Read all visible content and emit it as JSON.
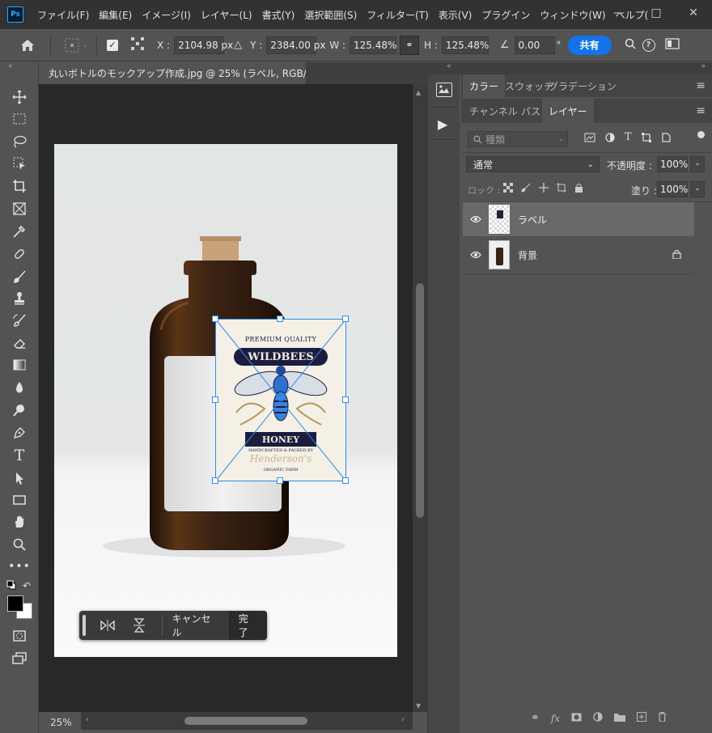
{
  "app": {
    "logo": "Ps"
  },
  "menu": [
    "ファイル(F)",
    "編集(E)",
    "イメージ(I)",
    "レイヤー(L)",
    "書式(Y)",
    "選択範囲(S)",
    "フィルター(T)",
    "表示(V)",
    "プラグイン",
    "ウィンドウ(W)",
    "ヘルプ("
  ],
  "options": {
    "x_label": "X :",
    "x_value": "2104.98 px",
    "y_label": "Y :",
    "y_value": "2384.00 px",
    "w_label": "W :",
    "w_value": "125.48%",
    "h_label": "H :",
    "h_value": "125.48%",
    "angle_value": "0.00",
    "degree": "°",
    "share_label": "共有"
  },
  "document": {
    "tab_title": "丸いボトルのモックアップ作成.jpg @ 25% (ラベル, RGB/8)",
    "close_glyph": "×"
  },
  "status": {
    "zoom": "25%"
  },
  "panels": {
    "top_tabs": [
      "カラー",
      "スウォッチ",
      "グラデーション"
    ],
    "layer_tabs": [
      "チャンネル",
      "パス",
      "レイヤー"
    ],
    "search_placeholder": "種類",
    "blend_mode": "通常",
    "opacity_label": "不透明度 :",
    "opacity_value": "100%",
    "lock_label": "ロック :",
    "fill_label": "塗り :",
    "fill_value": "100%"
  },
  "layers": [
    {
      "name": "ラベル",
      "selected": true,
      "locked": false
    },
    {
      "name": "背景",
      "selected": false,
      "locked": true
    }
  ],
  "label_art": {
    "top_text": "PREMIUM QUALITY",
    "brand": "WILDBEES",
    "product": "HONEY",
    "small_text": "HANDCRAFTED & PACKED BY",
    "script_text": "Henderson's",
    "farm": "ORGANIC FARM"
  },
  "transform_bar": {
    "cancel": "キャンセル",
    "done": "完了"
  },
  "colors": {
    "accent": "#1473e6",
    "selection": "#2d8ceb",
    "bottle": "#3b2314"
  }
}
